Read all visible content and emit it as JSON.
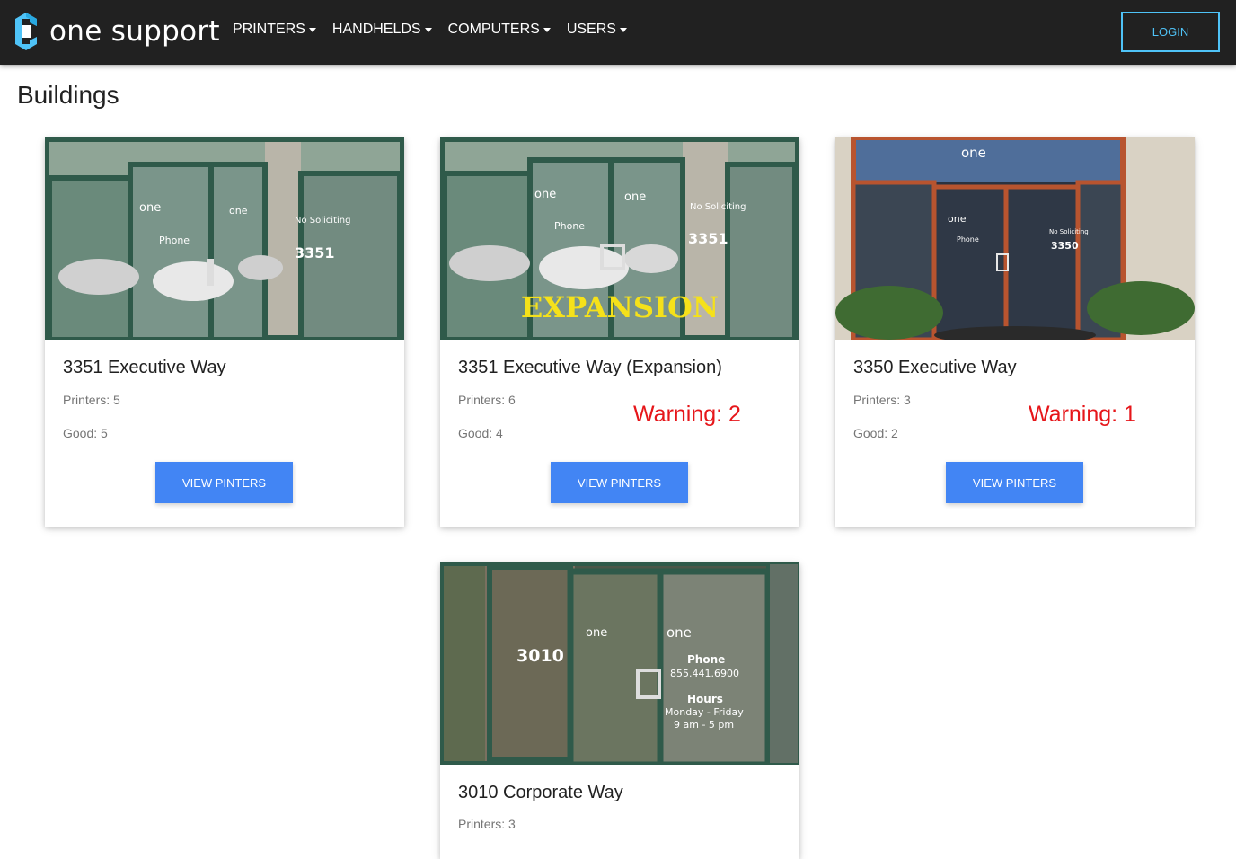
{
  "nav": {
    "brand_text": "one support",
    "items": [
      {
        "label": "PRINTERS"
      },
      {
        "label": "HANDHELDS"
      },
      {
        "label": "COMPUTERS"
      },
      {
        "label": "USERS"
      }
    ],
    "login_label": "LOGIN"
  },
  "page": {
    "title": "Buildings"
  },
  "buildings": [
    {
      "name": "3351 Executive Way",
      "printers": "Printers: 5",
      "good": "Good: 5",
      "warning": "",
      "button": "VIEW PINTERS",
      "photo_text": {
        "number": "3351",
        "sign": "No Soliciting",
        "phone": "Phone",
        "logo": "one",
        "overlay": ""
      }
    },
    {
      "name": "3351 Executive Way (Expansion)",
      "printers": "Printers: 6",
      "good": "Good: 4",
      "warning": "Warning: 2",
      "button": "VIEW PINTERS",
      "photo_text": {
        "number": "3351",
        "sign": "No Soliciting",
        "phone": "Phone",
        "logo": "one",
        "overlay": "EXPANSION"
      }
    },
    {
      "name": "3350 Executive Way",
      "printers": "Printers: 3",
      "good": "Good: 2",
      "warning": "Warning: 1",
      "button": "VIEW PINTERS",
      "photo_text": {
        "number": "3350",
        "sign": "No Soliciting",
        "phone": "Phone",
        "logo": "one",
        "overlay": ""
      }
    },
    {
      "name": "3010 Corporate Way",
      "printers": "Printers: 3",
      "good": "",
      "warning": "",
      "button": "",
      "photo_text": {
        "number": "3010",
        "sign": "",
        "phone": "Phone",
        "phone_number": "855.441.6900",
        "hours": "Hours",
        "hours_days": "Monday - Friday",
        "hours_time": "9 am - 5 pm",
        "logo": "one",
        "overlay": ""
      }
    }
  ],
  "colors": {
    "navbar": "#212121",
    "login_border": "#4fc3f7",
    "button": "#4285f4",
    "warning": "#e6161a",
    "logo_blue": "#4fc3f7"
  }
}
